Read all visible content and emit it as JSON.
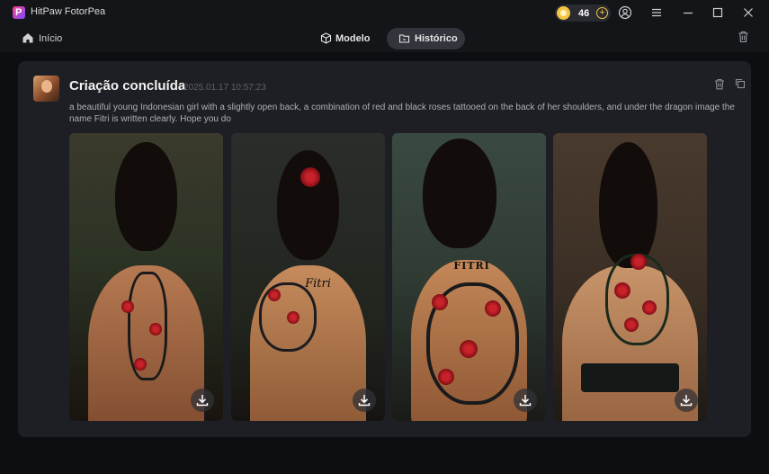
{
  "app": {
    "title": "HitPaw FotorPea",
    "coins": "46"
  },
  "nav": {
    "home_label": "Início",
    "tabs": [
      {
        "label": "Modelo",
        "active": false
      },
      {
        "label": "Histórico",
        "active": true
      }
    ]
  },
  "card": {
    "title": "Criação concluída",
    "timestamp": "2025.01.17 10:57:23",
    "prompt": "a beautiful young Indonesian girl with a slightly open back, a combination of red and black roses tattooed on the back of her shoulders, and under the dragon image the name Fitri is written clearly. Hope you do",
    "images": [
      {
        "text": ""
      },
      {
        "text": "Fitri"
      },
      {
        "text": "FITRI"
      },
      {
        "text": ""
      }
    ]
  },
  "colors": {
    "accent": "#f5c542",
    "background": "#0d0e12",
    "card": "#1e1f24"
  }
}
